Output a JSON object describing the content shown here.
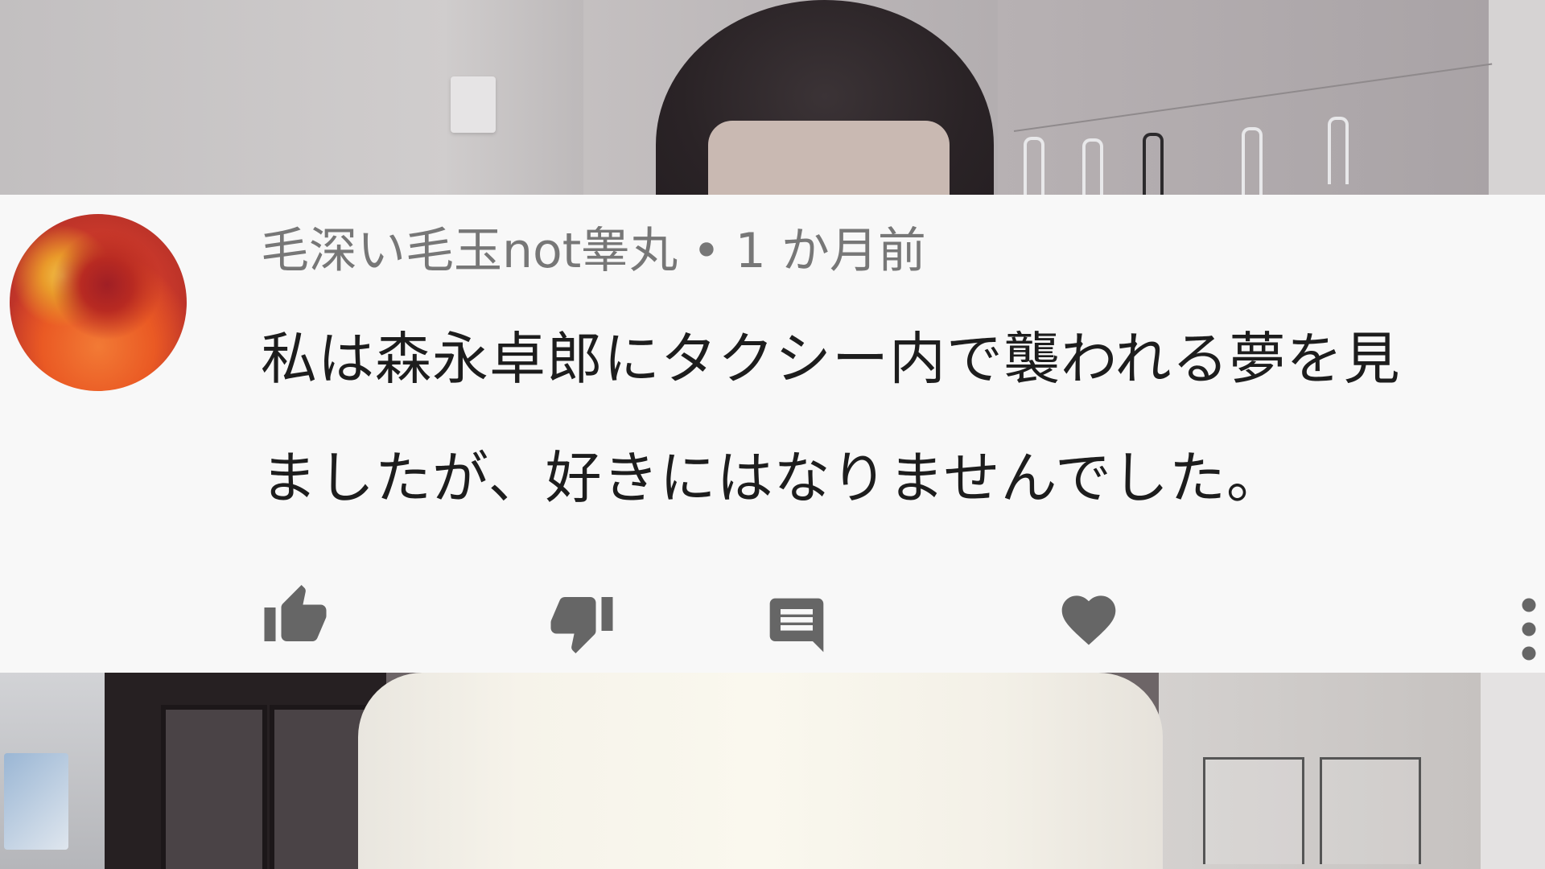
{
  "comment": {
    "author": "毛深い毛玉not睾丸",
    "separator": "•",
    "timestamp": "1 か月前",
    "body_lines": [
      "私は森永卓郎にタクシー内で襲われる夢を見",
      "ましたが、好きにはなりませんでした。"
    ]
  },
  "actions": {
    "like_icon": "thumb-up-icon",
    "dislike_icon": "thumb-down-icon",
    "reply_icon": "reply-comment-icon",
    "heart_icon": "heart-icon",
    "more_icon": "more-vert-icon"
  },
  "colors": {
    "card_background": "#f8f8f8",
    "meta_text": "#777777",
    "body_text": "#1d1d1d",
    "icon": "#666666"
  }
}
